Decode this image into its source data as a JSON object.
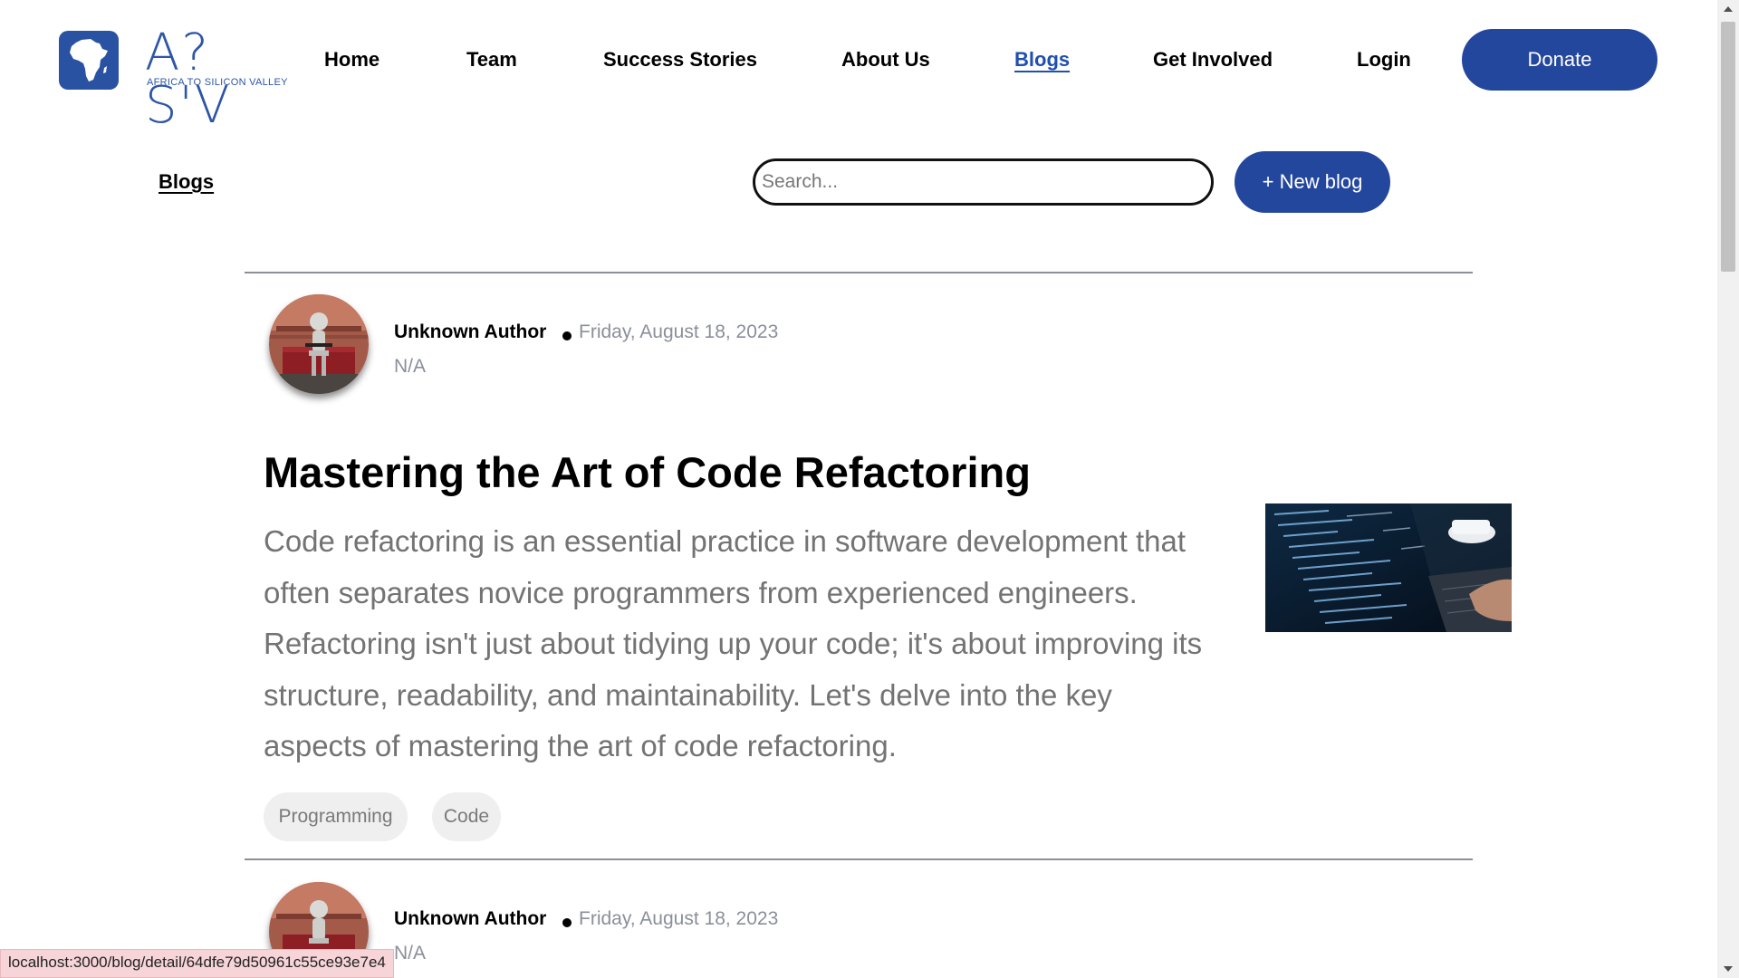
{
  "brand": {
    "logo_text": "A?S'V",
    "tagline": "AFRICA TO SILICON VALLEY",
    "color": "#2952a3"
  },
  "nav": {
    "items": [
      {
        "label": "Home"
      },
      {
        "label": "Team"
      },
      {
        "label": "Success Stories"
      },
      {
        "label": "About Us"
      },
      {
        "label": "Blogs",
        "active": true
      },
      {
        "label": "Get Involved"
      },
      {
        "label": "Login"
      }
    ],
    "donate_label": "Donate"
  },
  "toolbar": {
    "heading": "Blogs",
    "search_placeholder": "Search...",
    "new_blog_label": "+ New blog"
  },
  "posts": [
    {
      "author": "Unknown Author",
      "date": "Friday, August 18, 2023",
      "role": "N/A",
      "title": "Mastering the Art of Code Refactoring",
      "excerpt": "Code refactoring is an essential practice in software development that often separates novice programmers from experienced engineers. Refactoring isn't just about tidying up your code; it's about improving its structure, readability, and maintainability. Let's delve into the key aspects of mastering the art of code refactoring.",
      "tags": [
        "Programming",
        "Code"
      ]
    },
    {
      "author": "Unknown Author",
      "date": "Friday, August 18, 2023",
      "role": "N/A"
    }
  ],
  "status_url": "localhost:3000/blog/detail/64dfe79d50961c55ce93e7e4",
  "colors": {
    "primary_button": "#24479e",
    "active_link": "#1f4fb0",
    "muted_text": "#8a8f99",
    "tag_bg": "#efefef"
  },
  "icons": {
    "logo": "africa-map-icon",
    "avatar": "robot-avatar-image",
    "thumbnail": "laptop-code-image"
  }
}
